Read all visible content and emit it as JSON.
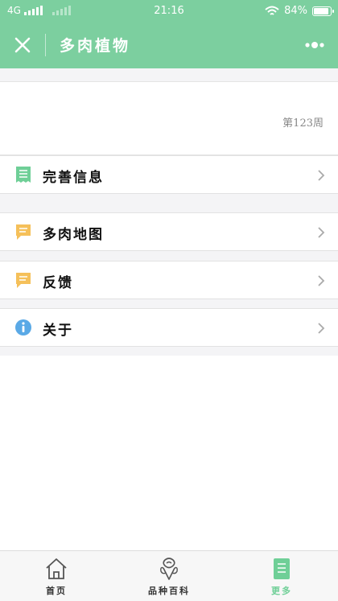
{
  "status_bar": {
    "network": "4G",
    "time": "21:16",
    "battery": "84%",
    "battery_level": 0.84
  },
  "nav": {
    "title": "多肉植物"
  },
  "header_card": {
    "week": "第123周"
  },
  "menu": [
    {
      "label": "完善信息",
      "icon": "document-icon",
      "color": "#6fcf97"
    },
    {
      "label": "多肉地图",
      "icon": "message-icon",
      "color": "#f5c05a"
    },
    {
      "label": "反馈",
      "icon": "message-icon",
      "color": "#f5c05a"
    },
    {
      "label": "关于",
      "icon": "info-icon",
      "color": "#5aa9e6"
    }
  ],
  "tabbar": [
    {
      "label": "首页",
      "icon": "home-icon",
      "active": false
    },
    {
      "label": "品种百科",
      "icon": "plant-icon",
      "active": false
    },
    {
      "label": "更多",
      "icon": "document-icon",
      "active": true
    }
  ],
  "colors": {
    "primary": "#7ccf9f",
    "active_tab": "#6fcf97",
    "background": "#f4f4f6"
  }
}
